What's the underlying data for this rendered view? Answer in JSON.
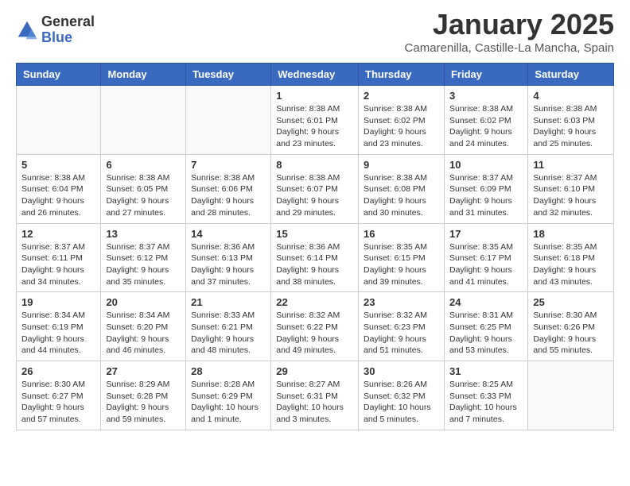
{
  "logo": {
    "general": "General",
    "blue": "Blue"
  },
  "title": "January 2025",
  "subtitle": "Camarenilla, Castille-La Mancha, Spain",
  "days_of_week": [
    "Sunday",
    "Monday",
    "Tuesday",
    "Wednesday",
    "Thursday",
    "Friday",
    "Saturday"
  ],
  "weeks": [
    [
      {
        "num": "",
        "info": ""
      },
      {
        "num": "",
        "info": ""
      },
      {
        "num": "",
        "info": ""
      },
      {
        "num": "1",
        "info": "Sunrise: 8:38 AM\nSunset: 6:01 PM\nDaylight: 9 hours\nand 23 minutes."
      },
      {
        "num": "2",
        "info": "Sunrise: 8:38 AM\nSunset: 6:02 PM\nDaylight: 9 hours\nand 23 minutes."
      },
      {
        "num": "3",
        "info": "Sunrise: 8:38 AM\nSunset: 6:02 PM\nDaylight: 9 hours\nand 24 minutes."
      },
      {
        "num": "4",
        "info": "Sunrise: 8:38 AM\nSunset: 6:03 PM\nDaylight: 9 hours\nand 25 minutes."
      }
    ],
    [
      {
        "num": "5",
        "info": "Sunrise: 8:38 AM\nSunset: 6:04 PM\nDaylight: 9 hours\nand 26 minutes."
      },
      {
        "num": "6",
        "info": "Sunrise: 8:38 AM\nSunset: 6:05 PM\nDaylight: 9 hours\nand 27 minutes."
      },
      {
        "num": "7",
        "info": "Sunrise: 8:38 AM\nSunset: 6:06 PM\nDaylight: 9 hours\nand 28 minutes."
      },
      {
        "num": "8",
        "info": "Sunrise: 8:38 AM\nSunset: 6:07 PM\nDaylight: 9 hours\nand 29 minutes."
      },
      {
        "num": "9",
        "info": "Sunrise: 8:38 AM\nSunset: 6:08 PM\nDaylight: 9 hours\nand 30 minutes."
      },
      {
        "num": "10",
        "info": "Sunrise: 8:37 AM\nSunset: 6:09 PM\nDaylight: 9 hours\nand 31 minutes."
      },
      {
        "num": "11",
        "info": "Sunrise: 8:37 AM\nSunset: 6:10 PM\nDaylight: 9 hours\nand 32 minutes."
      }
    ],
    [
      {
        "num": "12",
        "info": "Sunrise: 8:37 AM\nSunset: 6:11 PM\nDaylight: 9 hours\nand 34 minutes."
      },
      {
        "num": "13",
        "info": "Sunrise: 8:37 AM\nSunset: 6:12 PM\nDaylight: 9 hours\nand 35 minutes."
      },
      {
        "num": "14",
        "info": "Sunrise: 8:36 AM\nSunset: 6:13 PM\nDaylight: 9 hours\nand 37 minutes."
      },
      {
        "num": "15",
        "info": "Sunrise: 8:36 AM\nSunset: 6:14 PM\nDaylight: 9 hours\nand 38 minutes."
      },
      {
        "num": "16",
        "info": "Sunrise: 8:35 AM\nSunset: 6:15 PM\nDaylight: 9 hours\nand 39 minutes."
      },
      {
        "num": "17",
        "info": "Sunrise: 8:35 AM\nSunset: 6:17 PM\nDaylight: 9 hours\nand 41 minutes."
      },
      {
        "num": "18",
        "info": "Sunrise: 8:35 AM\nSunset: 6:18 PM\nDaylight: 9 hours\nand 43 minutes."
      }
    ],
    [
      {
        "num": "19",
        "info": "Sunrise: 8:34 AM\nSunset: 6:19 PM\nDaylight: 9 hours\nand 44 minutes."
      },
      {
        "num": "20",
        "info": "Sunrise: 8:34 AM\nSunset: 6:20 PM\nDaylight: 9 hours\nand 46 minutes."
      },
      {
        "num": "21",
        "info": "Sunrise: 8:33 AM\nSunset: 6:21 PM\nDaylight: 9 hours\nand 48 minutes."
      },
      {
        "num": "22",
        "info": "Sunrise: 8:32 AM\nSunset: 6:22 PM\nDaylight: 9 hours\nand 49 minutes."
      },
      {
        "num": "23",
        "info": "Sunrise: 8:32 AM\nSunset: 6:23 PM\nDaylight: 9 hours\nand 51 minutes."
      },
      {
        "num": "24",
        "info": "Sunrise: 8:31 AM\nSunset: 6:25 PM\nDaylight: 9 hours\nand 53 minutes."
      },
      {
        "num": "25",
        "info": "Sunrise: 8:30 AM\nSunset: 6:26 PM\nDaylight: 9 hours\nand 55 minutes."
      }
    ],
    [
      {
        "num": "26",
        "info": "Sunrise: 8:30 AM\nSunset: 6:27 PM\nDaylight: 9 hours\nand 57 minutes."
      },
      {
        "num": "27",
        "info": "Sunrise: 8:29 AM\nSunset: 6:28 PM\nDaylight: 9 hours\nand 59 minutes."
      },
      {
        "num": "28",
        "info": "Sunrise: 8:28 AM\nSunset: 6:29 PM\nDaylight: 10 hours\nand 1 minute."
      },
      {
        "num": "29",
        "info": "Sunrise: 8:27 AM\nSunset: 6:31 PM\nDaylight: 10 hours\nand 3 minutes."
      },
      {
        "num": "30",
        "info": "Sunrise: 8:26 AM\nSunset: 6:32 PM\nDaylight: 10 hours\nand 5 minutes."
      },
      {
        "num": "31",
        "info": "Sunrise: 8:25 AM\nSunset: 6:33 PM\nDaylight: 10 hours\nand 7 minutes."
      },
      {
        "num": "",
        "info": ""
      }
    ]
  ]
}
